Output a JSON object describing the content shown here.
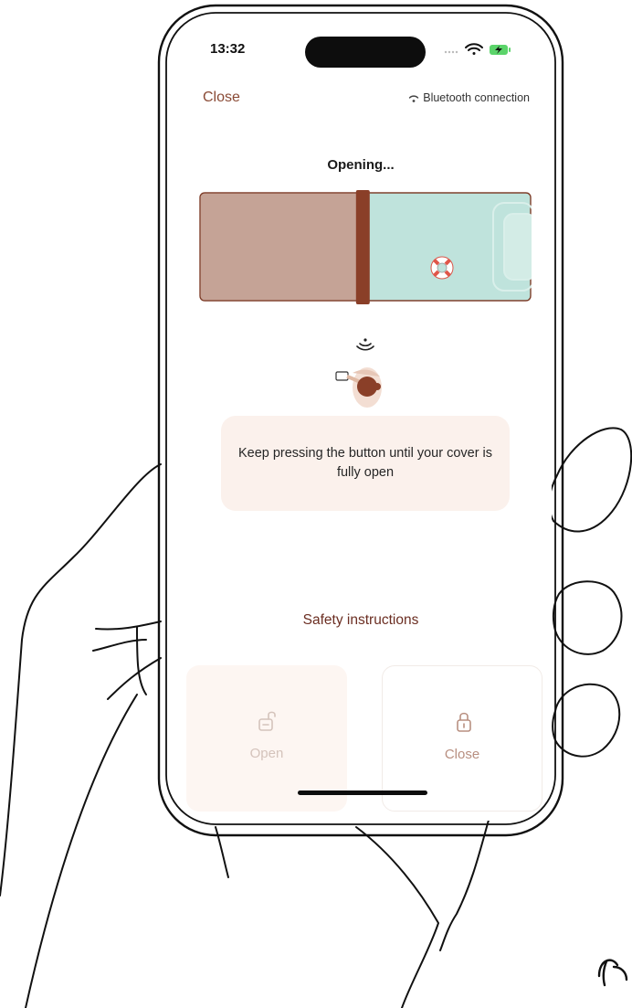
{
  "status_bar": {
    "time": "13:32"
  },
  "header": {
    "close_label": "Close",
    "bluetooth_label": "Bluetooth connection"
  },
  "main": {
    "title": "Opening...",
    "hint": "Keep pressing the button until your cover is fully open",
    "safety_label": "Safety instructions",
    "cover_open_fraction": 0.48
  },
  "controls": {
    "open_label": "Open",
    "close_label": "Close"
  },
  "colors": {
    "accent": "#8a4a35",
    "cover": "#c5a396",
    "water": "#bfe3dc",
    "roller": "#8a3f28",
    "hint_bg": "#fbf1ec"
  },
  "icons": [
    "wifi-icon",
    "battery-icon",
    "bluetooth-signal-icon",
    "signal-waves-icon",
    "lifebuoy-icon",
    "unlock-icon",
    "lock-icon"
  ]
}
